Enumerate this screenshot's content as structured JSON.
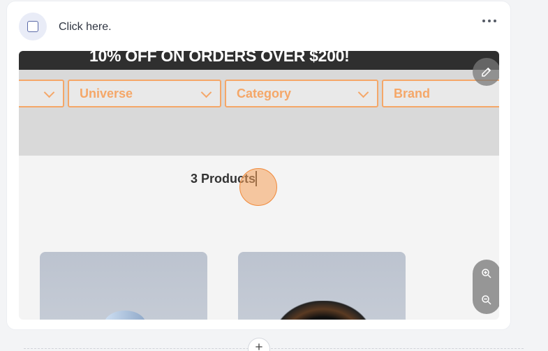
{
  "step": {
    "instruction": "Click here."
  },
  "screenshot": {
    "banner": "10% OFF ON ORDERS OVER $200!",
    "filters": [
      {
        "label": ""
      },
      {
        "label": "Universe"
      },
      {
        "label": "Category"
      },
      {
        "label": "Brand"
      }
    ],
    "products_count": "3 Products"
  },
  "colors": {
    "accent_orange": "#f5a768",
    "banner_bg": "#2f2f2f",
    "card_bg": "#ffffff"
  },
  "icons": {
    "more": "more-horizontal-icon",
    "edit": "pencil-icon",
    "zoom_in": "zoom-in-icon",
    "zoom_out": "zoom-out-icon",
    "add": "plus-icon"
  }
}
